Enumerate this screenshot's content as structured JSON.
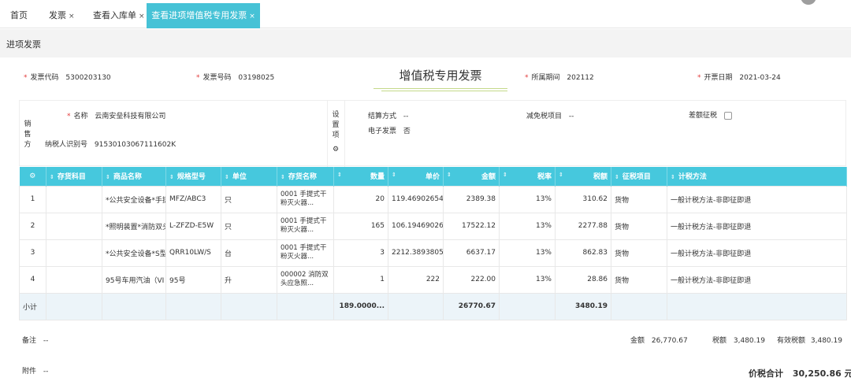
{
  "tabs": [
    {
      "label": "首页",
      "closable": false
    },
    {
      "label": "发票",
      "closable": true
    },
    {
      "label": "查看入库单",
      "closable": true
    },
    {
      "label": "查看进项增值税专用发票",
      "closable": true,
      "active": true
    }
  ],
  "close_glyph": "×",
  "page_title": "进项发票",
  "invoice_title": "增值税专用发票",
  "header_fields": {
    "code": {
      "label": "发票代码",
      "value": "5300203130"
    },
    "number": {
      "label": "发票号码",
      "value": "03198025"
    },
    "period": {
      "label": "所属期间",
      "value": "202112"
    },
    "date": {
      "label": "开票日期",
      "value": "2021-03-24"
    }
  },
  "seller": {
    "section_label": [
      "销",
      "售",
      "方"
    ],
    "name": {
      "label": "名称",
      "value": "云南安垒科技有限公司"
    },
    "tax_id": {
      "label": "纳税人识别号",
      "value": "91530103067111602K"
    }
  },
  "settings": {
    "section_label": [
      "设",
      "置",
      "项"
    ],
    "settlement": {
      "label": "结算方式",
      "value": "--"
    },
    "e_invoice": {
      "label": "电子发票",
      "value": "否"
    },
    "tax_reduction": {
      "label": "减免税项目",
      "value": "--"
    },
    "diff_tax": {
      "label": "差额征税",
      "checked": false
    }
  },
  "table": {
    "headers": [
      "存货科目",
      "商品名称",
      "规格型号",
      "单位",
      "存货名称",
      "数量",
      "单价",
      "金额",
      "税率",
      "税额",
      "征税项目",
      "计税方法"
    ],
    "rows": [
      {
        "no": "1",
        "account": "",
        "name": "*公共安全设备*手提",
        "spec": "MFZ/ABC3",
        "unit": "只",
        "stock": "0001 手提式干粉灭火器...",
        "qty": "20",
        "price": "119.46902654E",
        "amount": "2389.38",
        "rate": "13%",
        "tax": "310.62",
        "item": "货物",
        "method": "一般计税方法-非即征即退"
      },
      {
        "no": "2",
        "account": "",
        "name": "*照明装置*消防双头",
        "spec": "L-ZFZD-E5W",
        "unit": "只",
        "stock": "0001 手提式干粉灭火器...",
        "qty": "165",
        "price": "106.194690265",
        "amount": "17522.12",
        "rate": "13%",
        "tax": "2277.88",
        "item": "货物",
        "method": "一般计税方法-非即征即退"
      },
      {
        "no": "3",
        "account": "",
        "name": "*公共安全设备*S型",
        "spec": "QRR10LW/S",
        "unit": "台",
        "stock": "0001 手提式干粉灭火器...",
        "qty": "3",
        "price": "2212.38938053",
        "amount": "6637.17",
        "rate": "13%",
        "tax": "862.83",
        "item": "货物",
        "method": "一般计税方法-非即征即退"
      },
      {
        "no": "4",
        "account": "",
        "name": "95号车用汽油（VI",
        "spec": "95号",
        "unit": "升",
        "stock": "000002 消防双头应急照...",
        "qty": "1",
        "price": "222",
        "amount": "222.00",
        "rate": "13%",
        "tax": "28.86",
        "item": "货物",
        "method": "一般计税方法-非即征即退"
      }
    ],
    "subtotal": {
      "label": "小计",
      "qty": "189.0000...",
      "amount": "26770.67",
      "tax": "3480.19"
    }
  },
  "footer": {
    "remark": {
      "label": "备注",
      "value": "--"
    },
    "attachment": {
      "label": "附件",
      "value": "--"
    },
    "amount": {
      "label": "金额",
      "value": "26,770.67"
    },
    "tax": {
      "label": "税额",
      "value": "3,480.19"
    },
    "valid_tax": {
      "label": "有效税额",
      "value": "3,480.19"
    },
    "total": {
      "label": "价税合计",
      "value": "30,250.86 元"
    }
  },
  "colors": {
    "accent": "#46c8dd",
    "required": "#e23b3b"
  },
  "icons": {
    "settings": "gear-icon",
    "sort": "sort-arrows-icon",
    "close": "close-icon"
  }
}
